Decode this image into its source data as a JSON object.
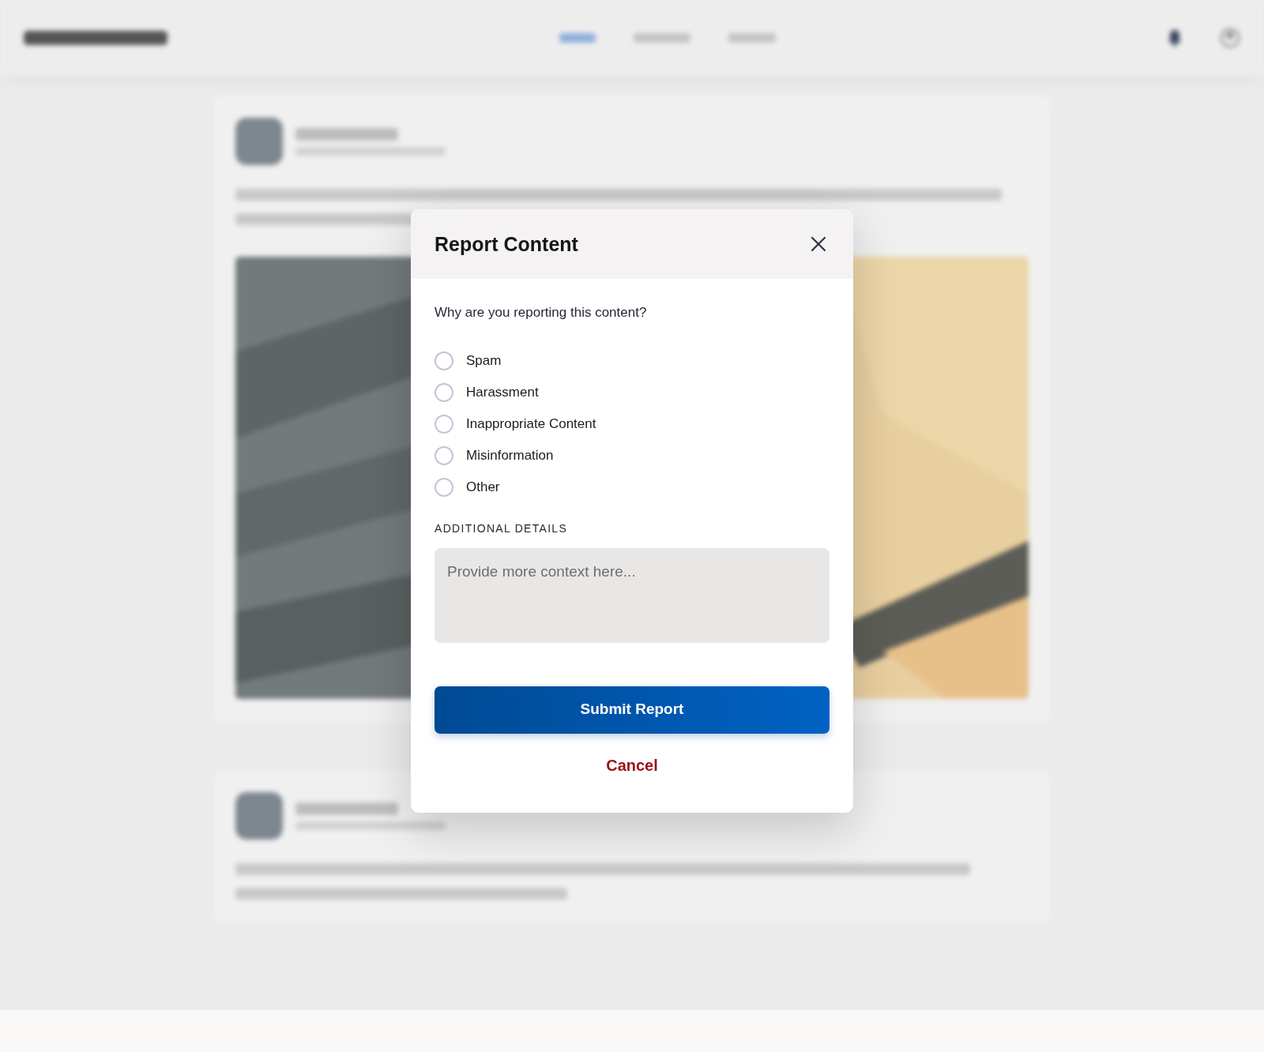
{
  "app": {
    "nav": [
      {
        "selected": true
      },
      {
        "selected": false
      },
      {
        "selected": false
      }
    ]
  },
  "posts": [
    {
      "kind": "picture-post"
    },
    {
      "kind": "text-post"
    }
  ],
  "dialog": {
    "title": "Report Content",
    "prompt": "Why are you reporting this content?",
    "options": [
      {
        "label": "Spam",
        "selected": false
      },
      {
        "label": "Harassment",
        "selected": false
      },
      {
        "label": "Inappropriate Content",
        "selected": false
      },
      {
        "label": "Misinformation",
        "selected": false
      },
      {
        "label": "Other",
        "selected": false
      }
    ],
    "details_label": "ADDITIONAL DETAILS",
    "details": {
      "placeholder": "Provide more context here..."
    },
    "submit": "Submit Report",
    "cancel": "Cancel"
  }
}
